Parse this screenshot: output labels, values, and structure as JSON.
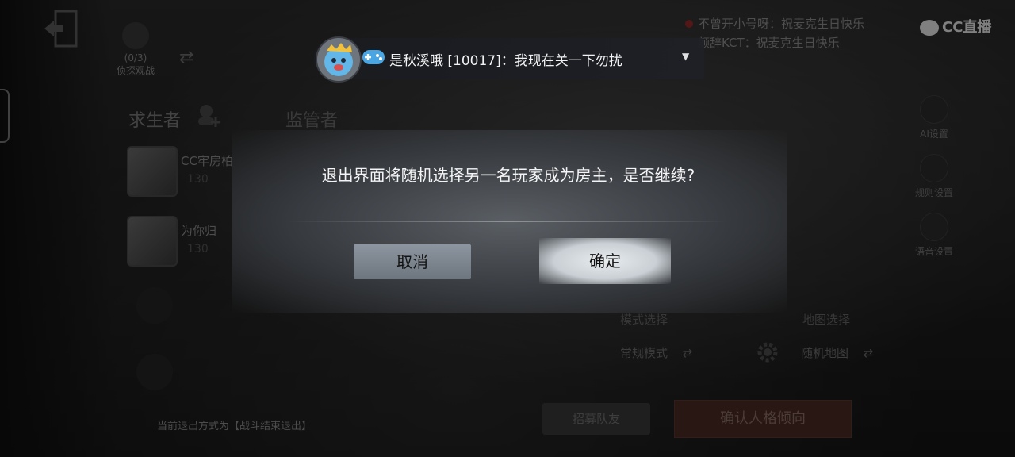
{
  "topbar": {
    "spectate_count": "(0/3)",
    "spectate_label": "侦探观战"
  },
  "tabs": {
    "survivor": "求生者",
    "hunter": "监管者"
  },
  "players": [
    {
      "name": "CC牢房柏",
      "level": "130"
    },
    {
      "name": "为你归",
      "level": "130"
    }
  ],
  "exit_mode": "当前退出方式为【战斗结束退出】",
  "right_panel": [
    {
      "icon": "ai-settings-icon",
      "label": "AI设置"
    },
    {
      "icon": "rules-settings-icon",
      "label": "规则设置"
    },
    {
      "icon": "voice-settings-icon",
      "label": "语音设置"
    }
  ],
  "mode": {
    "mode_label": "模式选择",
    "mode_value": "常规模式",
    "map_label": "地图选择",
    "map_value": "随机地图"
  },
  "bottom_buttons": {
    "invite": "招募队友",
    "confirm_pref": "确认人格倾向"
  },
  "chat_overlay": [
    "不曾开小号呀：祝麦克生日快乐",
    "颜辞KCT：祝麦克生日快乐"
  ],
  "watermark": "CC直播",
  "notification": {
    "text": "是秋溪哦 [10017]：我现在关一下勿扰"
  },
  "dialog": {
    "message": "退出界面将随机选择另一名玩家成为房主，是否继续?",
    "cancel": "取消",
    "confirm": "确定"
  },
  "colors": {
    "confirm_pref_bg": "#4a2a24",
    "chat_dot": "#9a2b2b"
  }
}
